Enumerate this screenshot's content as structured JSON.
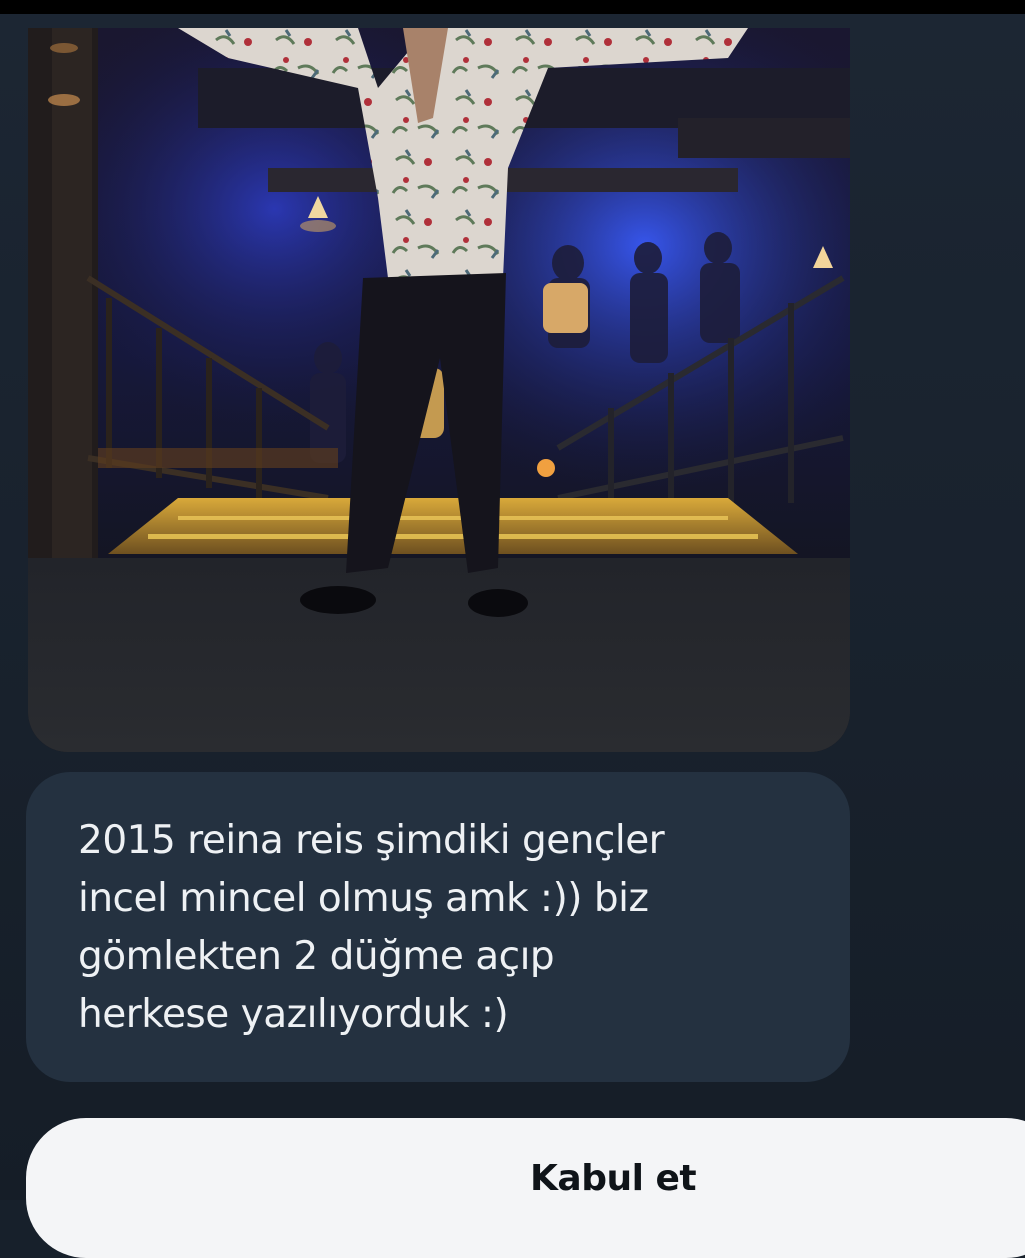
{
  "conversation": {
    "photo": {
      "icon": "photo-attachment"
    },
    "message": {
      "text": "2015 reina reis şimdiki gençler\nincel mincel olmuş amk :)) biz\ngömlekten 2 düğme açıp\nherkese yazılıyorduk :)"
    }
  },
  "actions": {
    "accept_label": "Kabul et"
  },
  "colors": {
    "background": "#17202b",
    "bubble": "#243140",
    "message_text": "#eef1f4",
    "button_bg": "#f4f5f7",
    "button_text": "#0f1419"
  }
}
